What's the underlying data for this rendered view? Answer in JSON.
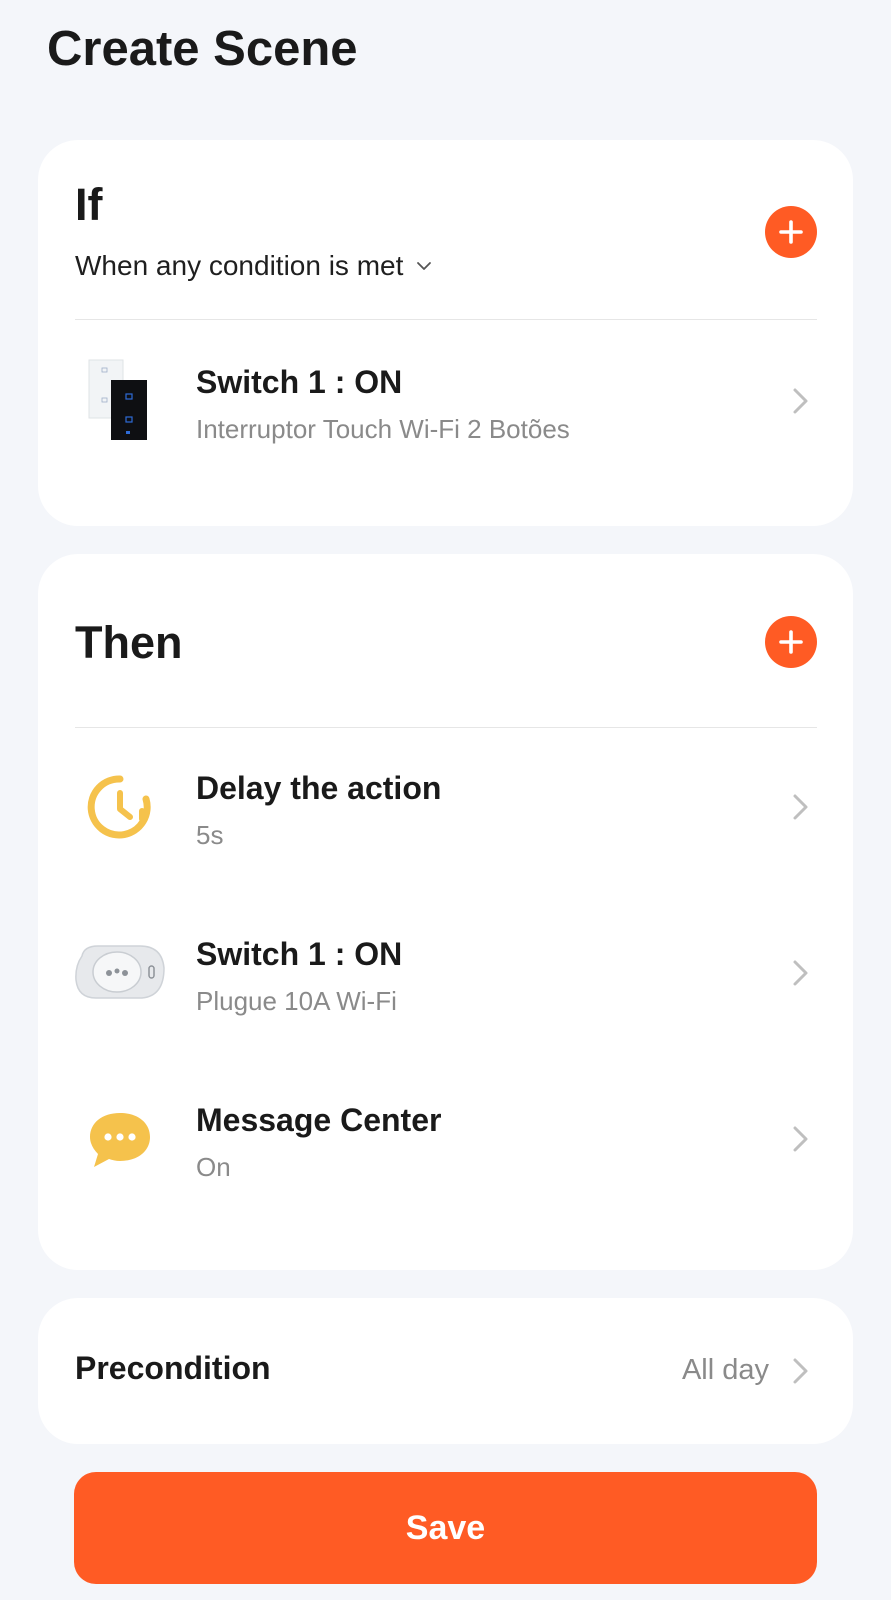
{
  "page": {
    "title": "Create Scene"
  },
  "if_section": {
    "title": "If",
    "condition_mode": "When any condition is met",
    "add_icon": "plus-circle-icon",
    "conditions": [
      {
        "title": "Switch 1 : ON",
        "subtitle": "Interruptor Touch Wi-Fi 2 Botões",
        "icon": "touch-switch-device-icon"
      }
    ]
  },
  "then_section": {
    "title": "Then",
    "add_icon": "plus-circle-icon",
    "actions": [
      {
        "title": "Delay the action",
        "subtitle": "5s",
        "icon": "timer-icon"
      },
      {
        "title": "Switch 1 : ON",
        "subtitle": "Plugue 10A Wi-Fi",
        "icon": "smart-plug-device-icon"
      },
      {
        "title": "Message Center",
        "subtitle": "On",
        "icon": "chat-bubble-icon"
      }
    ]
  },
  "precondition": {
    "label": "Precondition",
    "value": "All day"
  },
  "save": {
    "label": "Save"
  },
  "colors": {
    "accent": "#ff5b24",
    "background": "#f4f6fa",
    "card": "#ffffff",
    "timer_icon": "#f5c24c",
    "message_icon": "#f5c24c"
  }
}
